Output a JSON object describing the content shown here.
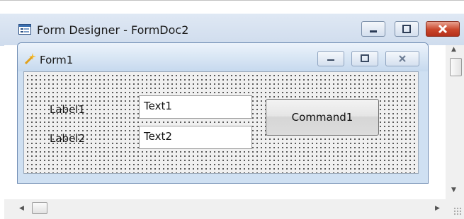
{
  "window": {
    "title": "Form Designer - FormDoc2",
    "app_icon": "form-designer-icon",
    "buttons": [
      "minimize-icon",
      "maximize-icon",
      "close-icon"
    ]
  },
  "form": {
    "title": "Form1",
    "icon": "form-wand-icon",
    "buttons": [
      "minimize-icon",
      "maximize-icon",
      "close-icon"
    ]
  },
  "controls": {
    "label1": "Label1",
    "label2": "Label2",
    "text1": "Text1",
    "text2": "Text2",
    "command1": "Command1"
  },
  "colors": {
    "close_accent": "#c9452a",
    "title_bar": "#d3deec"
  }
}
